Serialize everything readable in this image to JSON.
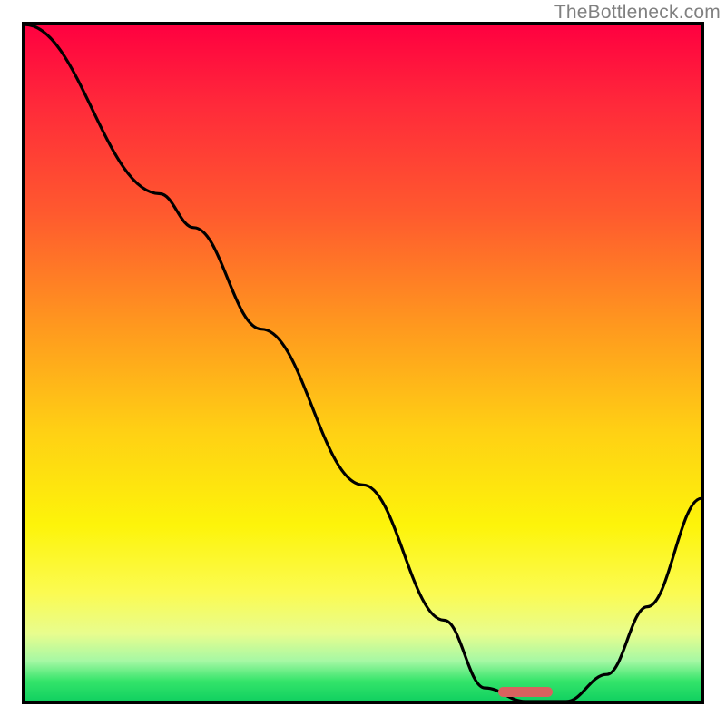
{
  "watermark": "TheBottleneck.com",
  "chart_data": {
    "type": "line",
    "title": "",
    "xlabel": "",
    "ylabel": "",
    "xlim": [
      0,
      100
    ],
    "ylim": [
      0,
      100
    ],
    "grid": false,
    "legend": false,
    "series": [
      {
        "name": "curve",
        "x": [
          0,
          20,
          25,
          35,
          50,
          62,
          68,
          74,
          80,
          86,
          92,
          100
        ],
        "values": [
          100,
          75,
          70,
          55,
          32,
          12,
          2,
          0,
          0,
          4,
          14,
          30
        ]
      }
    ],
    "marker": {
      "x_start": 70,
      "x_end": 78,
      "y": 1.5,
      "color": "#d9625f"
    },
    "background_gradient": {
      "top": "#ff0040",
      "bottom": "#10d060"
    }
  }
}
